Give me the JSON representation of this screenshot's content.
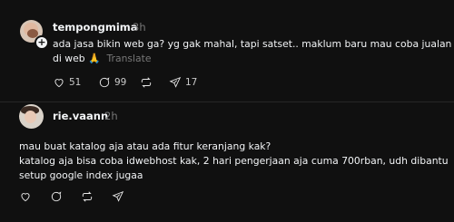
{
  "posts": [
    {
      "username": "tempongmima",
      "time": "3h",
      "text_line1": "ada jasa bikin web ga? yg gak mahal, tapi satset.. maklum baru mau coba jualan",
      "text_line2": "di web",
      "emoji": "🙏",
      "translate": "Translate",
      "likes": "51",
      "replies": "99",
      "shares": "17"
    },
    {
      "username": "rie.vaann",
      "time": "2h",
      "line1": "mau buat katalog aja atau ada fitur keranjang kak?",
      "line2": "katalog aja bisa coba idwebhost kak, 2 hari pengerjaan aja cuma 700rban, udh dibantu",
      "line3": "setup google index jugaa"
    }
  ]
}
